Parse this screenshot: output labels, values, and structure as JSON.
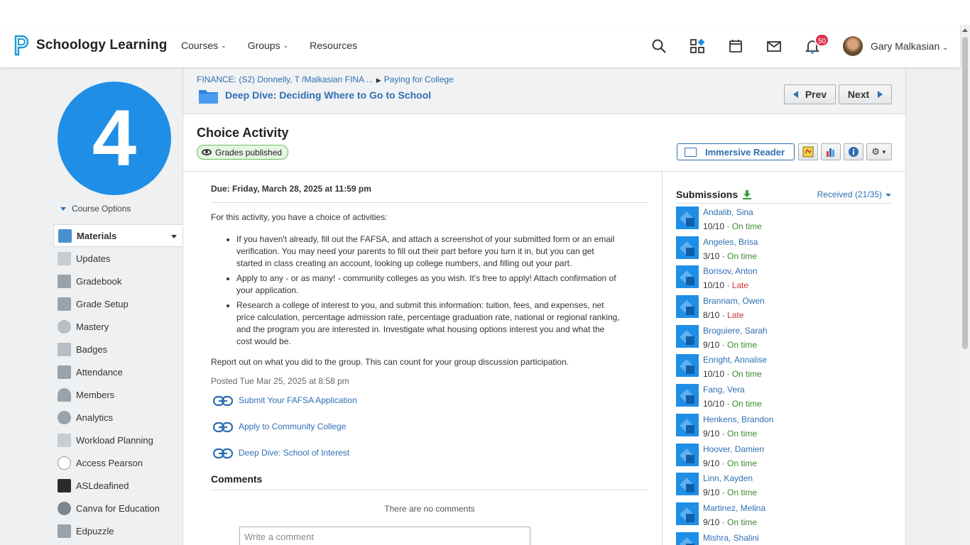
{
  "app": {
    "logo_text": "Schoology Learning",
    "nav": [
      "Courses",
      "Groups",
      "Resources"
    ],
    "notification_count": "50",
    "user_name": "Gary Malkasian"
  },
  "course": {
    "number": "4",
    "options_label": "Course Options"
  },
  "sidebar": {
    "items": [
      {
        "label": "Materials",
        "icon": "materials-icon",
        "active": true
      },
      {
        "label": "Updates",
        "icon": "updates-icon"
      },
      {
        "label": "Gradebook",
        "icon": "gradebook-icon"
      },
      {
        "label": "Grade Setup",
        "icon": "grade-setup-icon"
      },
      {
        "label": "Mastery",
        "icon": "mastery-icon"
      },
      {
        "label": "Badges",
        "icon": "badges-icon"
      },
      {
        "label": "Attendance",
        "icon": "attendance-icon"
      },
      {
        "label": "Members",
        "icon": "members-icon"
      },
      {
        "label": "Analytics",
        "icon": "analytics-icon"
      },
      {
        "label": "Workload Planning",
        "icon": "workload-icon"
      },
      {
        "label": "Access Pearson",
        "icon": "pearson-icon"
      },
      {
        "label": "ASLdeafined",
        "icon": "asldeafined-icon"
      },
      {
        "label": "Canva for Education",
        "icon": "canva-icon"
      },
      {
        "label": "Edpuzzle",
        "icon": "edpuzzle-icon"
      }
    ]
  },
  "breadcrumb": {
    "course": "FINANCE: (S2) Donnelly, T /Malkasian FINA ...",
    "parent": "Paying for College",
    "folder": "Deep Dive: Deciding Where to Go to School"
  },
  "pager": {
    "prev": "Prev",
    "next": "Next"
  },
  "assignment": {
    "title": "Choice Activity",
    "status": "Grades published",
    "immersive_reader": "Immersive Reader",
    "due": "Due: Friday, March 28, 2025 at 11:59 pm",
    "intro": "For this activity, you have a choice of activities:",
    "bullets": [
      "If you haven't already, fill out the FAFSA, and attach a screenshot of your submitted form or an email verification. You may need your parents to fill out their part before you turn it in, but you can get started in class creating an account, looking up college numbers, and filling out your part.",
      "Apply to any - or as many! - community colleges as you wish. It's free to apply! Attach confirmation of your application.",
      "Research a college of interest to you, and submit this information: tuition, fees, and expenses, net price calculation, percentage admission rate, percentage graduation rate, national or regional ranking, and the program you are interested in. Investigate what housing options interest you and what the cost would be."
    ],
    "report": "Report out on what you did to the group. This can count for your group discussion participation.",
    "posted": "Posted Tue Mar 25, 2025 at 8:58 pm",
    "links": [
      "Submit Your FAFSA Application",
      "Apply to Community College",
      "Deep Dive: School of Interest"
    ]
  },
  "comments": {
    "heading": "Comments",
    "empty": "There are no comments",
    "placeholder": "Write a comment"
  },
  "submissions": {
    "heading": "Submissions",
    "received": "Received (21/35)",
    "rows": [
      {
        "name": "Andalib, Sina",
        "grade": "10/10",
        "status": "On time"
      },
      {
        "name": "Angeles, Brisa",
        "grade": "3/10",
        "status": "On time"
      },
      {
        "name": "Borisov, Anton",
        "grade": "10/10",
        "status": "Late"
      },
      {
        "name": "Brannam, Owen",
        "grade": "8/10",
        "status": "Late"
      },
      {
        "name": "Broguiere, Sarah",
        "grade": "9/10",
        "status": "On time"
      },
      {
        "name": "Enright, Annalise",
        "grade": "10/10",
        "status": "On time"
      },
      {
        "name": "Fang, Vera",
        "grade": "10/10",
        "status": "On time"
      },
      {
        "name": "Henkens, Brandon",
        "grade": "9/10",
        "status": "On time"
      },
      {
        "name": "Hoover, Damien",
        "grade": "9/10",
        "status": "On time"
      },
      {
        "name": "Linn, Kayden",
        "grade": "9/10",
        "status": "On time"
      },
      {
        "name": "Martinez, Melina",
        "grade": "9/10",
        "status": "On time"
      },
      {
        "name": "Mishra, Shalini",
        "grade": "",
        "status": ""
      }
    ]
  },
  "colors": {
    "accent": "#1f8ee6",
    "link": "#2f6fb3",
    "on_time": "#3c8a2e",
    "late": "#d13438"
  }
}
